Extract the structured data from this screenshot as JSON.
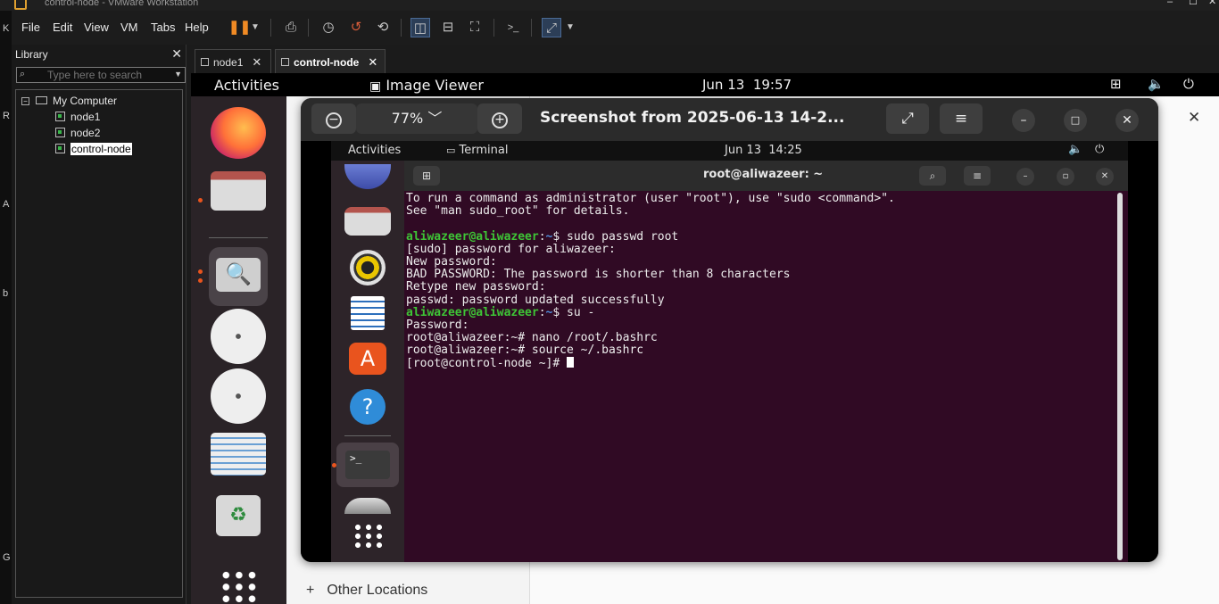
{
  "window": {
    "title": "control-node - VMware Workstation",
    "minimize": "–",
    "maximize": "☐",
    "close": "✕"
  },
  "left_strip": [
    "K",
    "R",
    "A",
    "b",
    "G"
  ],
  "menu": [
    "File",
    "Edit",
    "View",
    "VM",
    "Tabs",
    "Help"
  ],
  "toolbar_icons": [
    "pause-icon",
    "dropdown-icon",
    "send-ctrl-alt-del-icon",
    "snapshot-icon",
    "revert-snapshot-icon",
    "snapshot-manager-icon",
    "show-library-icon",
    "thumbnail-bar-icon",
    "fit-guest-icon",
    "console-view-icon",
    "full-screen-icon"
  ],
  "library": {
    "title": "Library",
    "close": "✕",
    "search_placeholder": "Type here to search",
    "expander": "−",
    "root": "My Computer",
    "vms": [
      "node1",
      "node2",
      "control-node"
    ],
    "selected": "control-node"
  },
  "tabs": [
    {
      "label": "node1",
      "active": false
    },
    {
      "label": "control-node",
      "active": true
    }
  ],
  "guest": {
    "topbar": {
      "activities": "Activities",
      "app": "Image Viewer",
      "date": "Jun 13",
      "time": "19:57"
    },
    "file_manager": {
      "other_locations": "Other Locations",
      "plus": "+"
    },
    "image_viewer": {
      "zoom": "77%",
      "title": "Screenshot from 2025-06-13 14-2...",
      "zoom_out": "−",
      "zoom_in": "+"
    },
    "screenshot": {
      "topbar": {
        "activities": "Activities",
        "app": "Terminal",
        "date": "Jun 13",
        "time": "14:25"
      },
      "terminal_title": "root@aliwazeer: ~",
      "lines": [
        {
          "segments": [
            {
              "t": "To run a command as administrator (user \"root\"), use \"sudo <command>\".",
              "c": ""
            }
          ]
        },
        {
          "segments": [
            {
              "t": "See \"man sudo_root\" for details.",
              "c": ""
            }
          ]
        },
        {
          "segments": [
            {
              "t": "",
              "c": ""
            }
          ]
        },
        {
          "segments": [
            {
              "t": "aliwazeer@aliwazeer",
              "c": "pg"
            },
            {
              "t": ":",
              "c": ""
            },
            {
              "t": "~",
              "c": "pb"
            },
            {
              "t": "$ sudo passwd root",
              "c": ""
            }
          ]
        },
        {
          "segments": [
            {
              "t": "[sudo] password for aliwazeer:",
              "c": ""
            }
          ]
        },
        {
          "segments": [
            {
              "t": "New password:",
              "c": ""
            }
          ]
        },
        {
          "segments": [
            {
              "t": "BAD PASSWORD: The password is shorter than 8 characters",
              "c": ""
            }
          ]
        },
        {
          "segments": [
            {
              "t": "Retype new password:",
              "c": ""
            }
          ]
        },
        {
          "segments": [
            {
              "t": "passwd: password updated successfully",
              "c": ""
            }
          ]
        },
        {
          "segments": [
            {
              "t": "aliwazeer@aliwazeer",
              "c": "pg"
            },
            {
              "t": ":",
              "c": ""
            },
            {
              "t": "~",
              "c": "pb"
            },
            {
              "t": "$ su -",
              "c": ""
            }
          ]
        },
        {
          "segments": [
            {
              "t": "Password:",
              "c": ""
            }
          ]
        },
        {
          "segments": [
            {
              "t": "root@aliwazeer:~# nano /root/.bashrc",
              "c": ""
            }
          ]
        },
        {
          "segments": [
            {
              "t": "root@aliwazeer:~# source ~/.bashrc",
              "c": ""
            }
          ]
        },
        {
          "segments": [
            {
              "t": "[root@control-node ~]# ",
              "c": ""
            }
          ],
          "cursor": true
        }
      ]
    }
  },
  "colors": {
    "terminal_bg": "#300a24",
    "prompt_green": "#3ec436",
    "prompt_blue": "#4f8edc",
    "ubuntu_orange": "#e9541e"
  }
}
